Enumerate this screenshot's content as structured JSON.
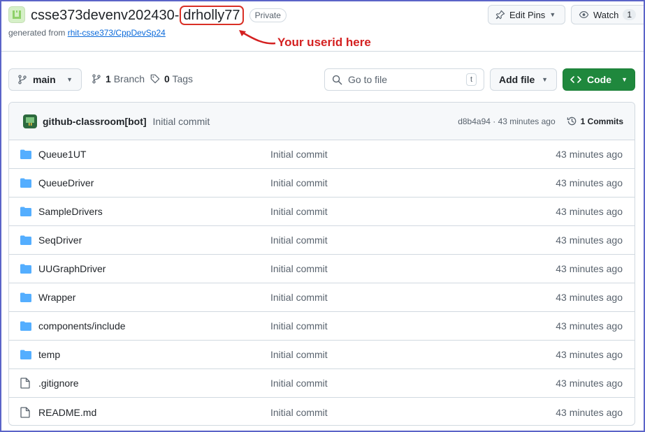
{
  "header": {
    "repo_name": "csse373devenv202430-",
    "repo_user": "drholly77",
    "visibility": "Private",
    "generated_prefix": "generated from",
    "template_link": "rhit-csse373/CppDevSp24",
    "annotation": "Your userid here",
    "edit_pins_label": "Edit Pins",
    "watch_label": "Watch",
    "watch_count": "1"
  },
  "toolbar": {
    "branch": "main",
    "branches_count": "1",
    "branches_label": "Branch",
    "tags_count": "0",
    "tags_label": "Tags",
    "search_placeholder": "Go to file",
    "search_shortcut": "t",
    "add_file_label": "Add file",
    "code_label": "Code"
  },
  "latest_commit": {
    "author": "github-classroom[bot]",
    "message": "Initial commit",
    "meta": "d8b4a94 · 43 minutes ago",
    "commits_label": "1 Commits"
  },
  "files": [
    {
      "name": "Queue1UT",
      "type": "folder",
      "commit": "Initial commit",
      "age": "43 minutes ago"
    },
    {
      "name": "QueueDriver",
      "type": "folder",
      "commit": "Initial commit",
      "age": "43 minutes ago"
    },
    {
      "name": "SampleDrivers",
      "type": "folder",
      "commit": "Initial commit",
      "age": "43 minutes ago"
    },
    {
      "name": "SeqDriver",
      "type": "folder",
      "commit": "Initial commit",
      "age": "43 minutes ago"
    },
    {
      "name": "UUGraphDriver",
      "type": "folder",
      "commit": "Initial commit",
      "age": "43 minutes ago"
    },
    {
      "name": "Wrapper",
      "type": "folder",
      "commit": "Initial commit",
      "age": "43 minutes ago"
    },
    {
      "name": "components/include",
      "type": "folder",
      "commit": "Initial commit",
      "age": "43 minutes ago"
    },
    {
      "name": "temp",
      "type": "folder",
      "commit": "Initial commit",
      "age": "43 minutes ago"
    },
    {
      "name": ".gitignore",
      "type": "file",
      "commit": "Initial commit",
      "age": "43 minutes ago"
    },
    {
      "name": "README.md",
      "type": "file",
      "commit": "Initial commit",
      "age": "43 minutes ago"
    }
  ],
  "colors": {
    "accent_green": "#1f883d",
    "link_blue": "#0969da",
    "annotation_red": "#d42020",
    "folder_blue": "#54aeff"
  }
}
